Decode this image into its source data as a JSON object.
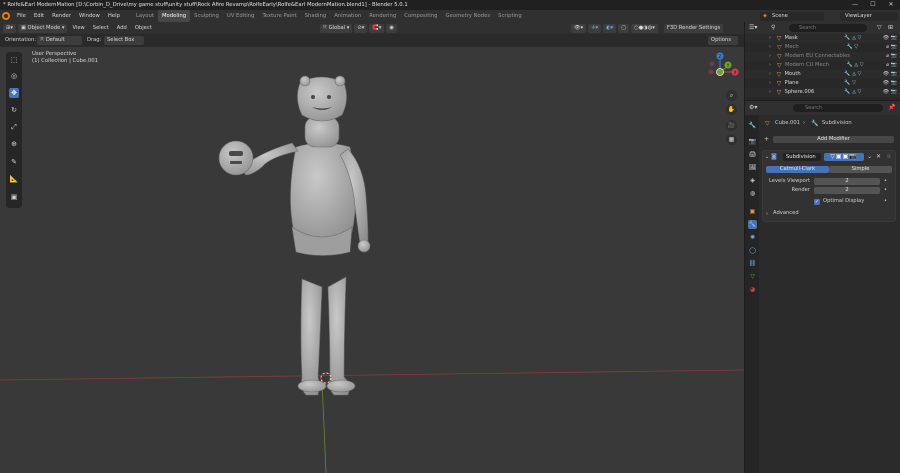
{
  "title_bar": {
    "title": "* Rolfe&Earl ModernMation [D:\\Corbin_D_Drive\\my game stuff\\unity stuff\\Rock Afire Revamp\\RolfeEarly\\Rolfe&Earl ModernMation.blend1] - Blender 5.0.1",
    "minimize": "—",
    "maximize": "☐",
    "close": "✕"
  },
  "menu": [
    "File",
    "Edit",
    "Render",
    "Window",
    "Help"
  ],
  "workspaces": [
    "Layout",
    "Modeling",
    "Sculpting",
    "UV Editing",
    "Texture Paint",
    "Shading",
    "Animation",
    "Rendering",
    "Compositing",
    "Geometry Nodes",
    "Scripting"
  ],
  "active_workspace": "Modeling",
  "scene": "Scene",
  "view_layer": "ViewLayer",
  "viewport_header": {
    "mode": "Object Mode",
    "menus": [
      "View",
      "Select",
      "Add",
      "Object"
    ],
    "transform_orientation": "Global",
    "render_settings": "F3D Render Settings",
    "orientation_label": "Orientation:",
    "orientation_value": "Default",
    "drag_label": "Drag:",
    "drag_value": "Select Box",
    "options": "Options"
  },
  "viewport_info": {
    "line1": "User Perspective",
    "line2": "(1) Collection | Cube.001"
  },
  "gizmo": {
    "z": "Z",
    "y": "Y",
    "x": "X"
  },
  "outliner": {
    "search_placeholder": "Search",
    "rows": [
      {
        "name": "Mask",
        "dim": false
      },
      {
        "name": "Mech",
        "dim": true
      },
      {
        "name": "Modern EU Connectables",
        "dim": true
      },
      {
        "name": "Modern CU Mech",
        "dim": true
      },
      {
        "name": "Mouth",
        "dim": false
      },
      {
        "name": "Plane",
        "dim": false
      },
      {
        "name": "Sphere.006",
        "dim": false
      }
    ]
  },
  "properties": {
    "search_placeholder": "Search",
    "breadcrumb_object": "Cube.001",
    "breadcrumb_modifier": "Subdivision",
    "add_modifier": "Add Modifier",
    "modifier_name": "Subdivision",
    "mode_options": [
      "Catmull-Clark",
      "Simple"
    ],
    "selected_mode": "Catmull-Clark",
    "levels_viewport_label": "Levels Viewport",
    "levels_viewport_value": "2",
    "render_label": "Render",
    "render_value": "2",
    "optimal_display_label": "Optimal Display",
    "optimal_display_checked": true,
    "advanced_label": "Advanced"
  },
  "colors": {
    "accent": "#4772b3",
    "viewport_bg": "#393939",
    "x_axis": "#d2434f",
    "y_axis": "#6ea230",
    "z_axis": "#3c7ed6"
  }
}
